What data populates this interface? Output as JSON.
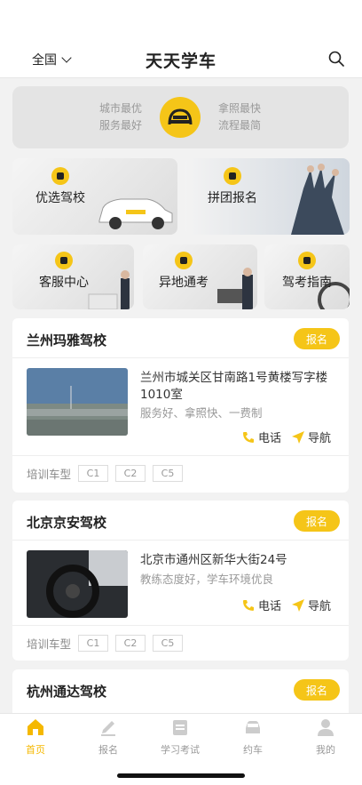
{
  "header": {
    "region": "全国",
    "title": "天天学车"
  },
  "banner": {
    "left_line1": "城市最优",
    "left_line2": "服务最好",
    "right_line1": "拿照最快",
    "right_line2": "流程最简"
  },
  "tiles": {
    "t1": "优选驾校",
    "t2": "拼团报名",
    "t3": "客服中心",
    "t4": "异地通考",
    "t5": "驾考指南"
  },
  "schools": [
    {
      "name": "兰州玛雅驾校",
      "enroll": "报名",
      "address": "兰州市城关区甘南路1号黄楼写字楼1010室",
      "tags": "服务好、拿照快、一费制",
      "call": "电话",
      "nav": "导航",
      "types_label": "培训车型",
      "types": [
        "C1",
        "C2",
        "C5"
      ]
    },
    {
      "name": "北京京安驾校",
      "enroll": "报名",
      "address": "北京市通州区新华大街24号",
      "tags": "教练态度好，学车环境优良",
      "call": "电话",
      "nav": "导航",
      "types_label": "培训车型",
      "types": [
        "C1",
        "C2",
        "C5"
      ]
    },
    {
      "name": "杭州通达驾校",
      "enroll": "报名"
    }
  ],
  "tabbar": {
    "home": "首页",
    "enroll": "报名",
    "study": "学习考试",
    "book": "约车",
    "mine": "我的"
  },
  "colors": {
    "accent": "#f5c518",
    "active_tab": "#f5b800"
  }
}
